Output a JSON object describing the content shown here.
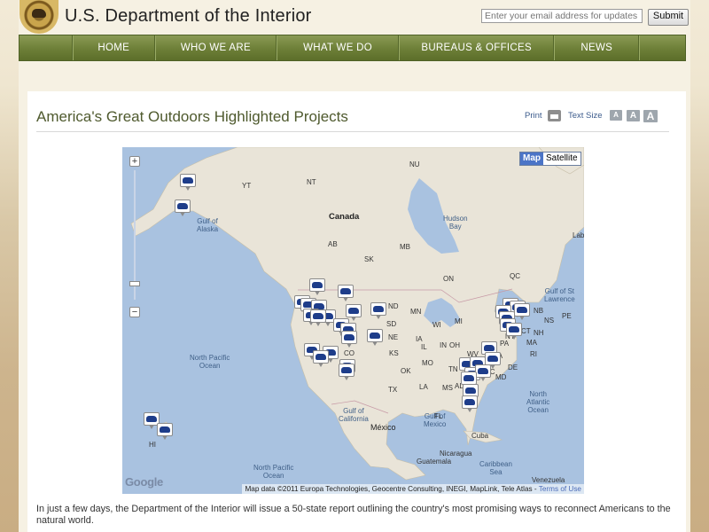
{
  "site": {
    "title": "U.S. Department of the Interior"
  },
  "email": {
    "placeholder": "Enter your email address for updates",
    "submit_label": "Submit"
  },
  "nav": {
    "items": [
      "HOME",
      "WHO WE ARE",
      "WHAT WE DO",
      "BUREAUS & OFFICES",
      "NEWS"
    ]
  },
  "page": {
    "title": "America's Great Outdoors Highlighted Projects",
    "print_label": "Print",
    "text_size_label": "Text Size",
    "text_size_buttons": [
      "A",
      "A",
      "A"
    ]
  },
  "map": {
    "toggle": {
      "map": "Map",
      "satellite": "Satellite"
    },
    "zoom": {
      "plus": "+",
      "minus": "−"
    },
    "countries": {
      "canada": "Canada",
      "mexico": "México"
    },
    "oceans": {
      "north_pacific_1": "North Pacific\nOcean",
      "north_pacific_2": "North Pacific\nOcean",
      "north_atlantic": "North\nAtlantic\nOcean",
      "gulf_alaska": "Gulf of\nAlaska",
      "hudson_bay": "Hudson\nBay",
      "gulf_mexico": "Gulf of\nMexico",
      "gulf_california": "Gulf of\nCalifornia",
      "gulf_st_lawrence": "Gulf of St\nLawrence",
      "caribbean": "Caribbean\nSea"
    },
    "places": [
      "NU",
      "YT",
      "NT",
      "AB",
      "SK",
      "MB",
      "ON",
      "QC",
      "Lab",
      "PE",
      "NB",
      "NS",
      "ND",
      "MN",
      "SD",
      "WI",
      "MI",
      "IA",
      "IL",
      "IN",
      "OH",
      "NE",
      "CO",
      "UT",
      "KS",
      "MO",
      "OK",
      "TX",
      "LA",
      "MS",
      "AL",
      "TN",
      "NC",
      "VA",
      "WV",
      "PA",
      "NY",
      "VT",
      "NH",
      "MA",
      "CT",
      "RI",
      "DE",
      "MD",
      "FL",
      "HI",
      "Cuba",
      "Nicaragua",
      "Guatemala",
      "Venezuela"
    ],
    "google": "Google",
    "credit": "Map data ©2011 Europa Technologies, Geocentre Consulting, INEGI, MapLink, Tele Atlas -",
    "terms": "Terms of Use"
  },
  "intro_text": "In just a few days, the Department of the Interior will issue a 50-state report outlining the country's most promising ways to reconnect Americans to the natural world.",
  "colors": {
    "nav": "#6d7f37",
    "title": "#4f5a2e",
    "water": "#a9c2e0",
    "land": "#e9e4d8",
    "marker": "#1e3d8a"
  },
  "icons": [
    "interior-seal-icon",
    "print-icon",
    "bison-marker-icon"
  ]
}
